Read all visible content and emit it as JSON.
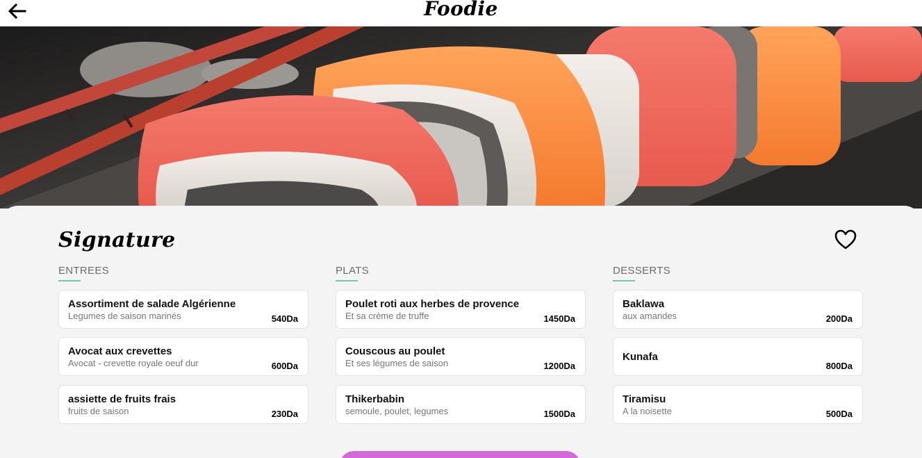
{
  "header": {
    "brand": "Foodie",
    "back_icon": "arrow-left-icon"
  },
  "hero": {
    "image_subject": "sushi-rolls-with-chopsticks"
  },
  "menu": {
    "title": "Signature",
    "favorite_icon": "heart-outline-icon",
    "columns": [
      {
        "label": "ENTREES",
        "items": [
          {
            "name": "Assortiment de salade Algérienne",
            "description": "Legumes de saison marinés",
            "price": "540Da"
          },
          {
            "name": "Avocat aux crevettes",
            "description": "Avocat - crevette royale oeuf dur",
            "price": "600Da"
          },
          {
            "name": "assiette de fruits frais",
            "description": "fruits de saison",
            "price": "230Da"
          }
        ]
      },
      {
        "label": "PLATS",
        "items": [
          {
            "name": "Poulet roti aux herbes de provence",
            "description": "Et sa crème de truffe",
            "price": "1450Da"
          },
          {
            "name": "Couscous au poulet",
            "description": "Et ses légumes de saison",
            "price": "1200Da"
          },
          {
            "name": "Thikerbabin",
            "description": "semoule, poulet, legumes",
            "price": "1500Da"
          }
        ]
      },
      {
        "label": "DESSERTS",
        "items": [
          {
            "name": "Baklawa",
            "description": "aux amandes",
            "price": "200Da"
          },
          {
            "name": "Kunafa",
            "description": "",
            "price": "800Da"
          },
          {
            "name": "Tiramisu",
            "description": "A la noisette",
            "price": "500Da"
          }
        ]
      }
    ]
  },
  "colors": {
    "accent_underline": "#66d1a8",
    "action_button": "#d46ad8"
  }
}
